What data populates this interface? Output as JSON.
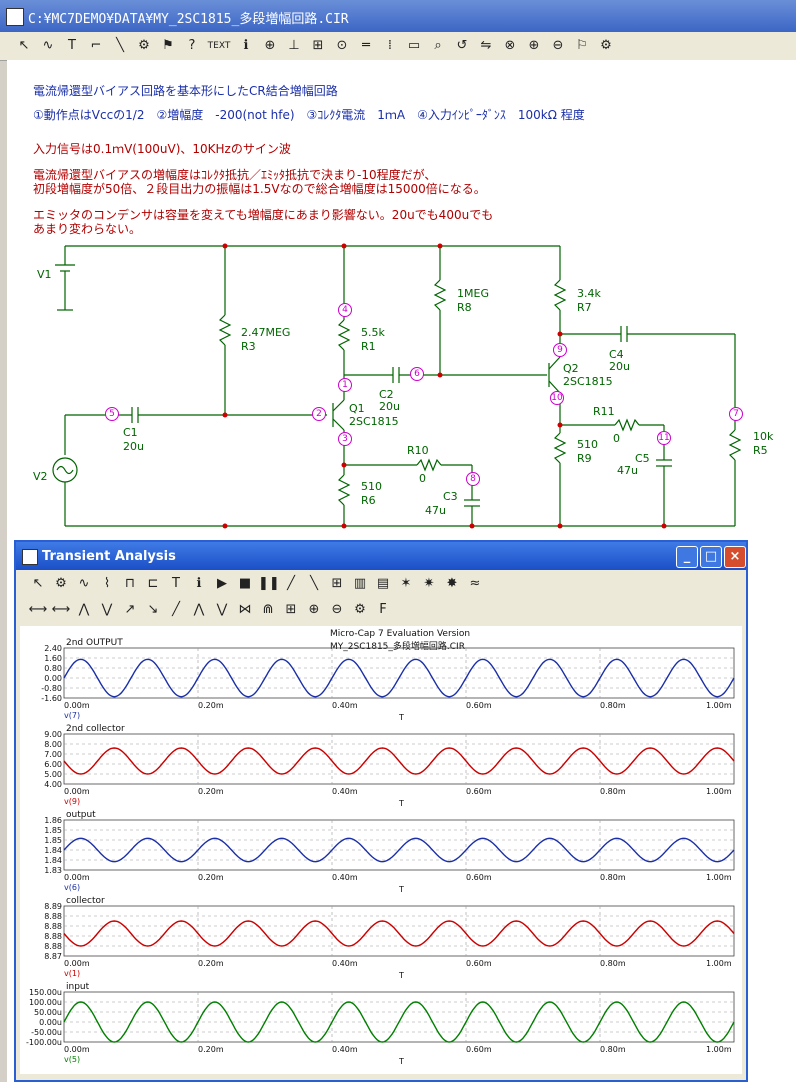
{
  "window_title": "C:¥MC7DEMO¥DATA¥MY_2SC1815_多段増幅回路.CIR",
  "toolbar_items": [
    "pointer-icon",
    "wire-icon",
    "text-tool-icon",
    "line-icon",
    "diagonal-icon",
    "component-icon",
    "flag-icon",
    "help-icon",
    "TEXT",
    "info-icon",
    "node-icon",
    "pin-icon",
    "grid-icon",
    "on-icon",
    "bus-icon",
    "dots-icon",
    "box-icon",
    "find-icon",
    "rotate-icon",
    "mirror-icon",
    "binoculars-icon",
    "zoom-in-icon",
    "zoom-out-icon",
    "flag2-icon",
    "settings-icon"
  ],
  "notes": {
    "line1": "電流帰還型バイアス回路を基本形にしたCR結合増幅回路",
    "line2": "①動作点はVccの1/2　②増幅度　-200(not hfe)　③ｺﾚｸﾀ電流　1ｍA　④入力ｲﾝﾋﾟｰﾀﾞﾝｽ　100kΩ 程度",
    "line3": "入力信号は0.1ｍV(100uV)、10KHzのサイン波",
    "line4": "電流帰還型バイアスの増幅度はｺﾚｸﾀ抵抗／ｴﾐｯﾀ抵抗で決まり-10程度だが、",
    "line5": "初段増幅度が50倍、２段目出力の振幅は1.5Vなので総合増幅度は15000倍になる。",
    "line6": "エミッタのコンデンサは容量を変えても増幅度にあまり影響ない。20uでも400uでも",
    "line7": "あまり変わらない。"
  },
  "schematic": {
    "V1": "V1",
    "V2": "V2",
    "R3": {
      "value": "2.47MEG",
      "name": "R3"
    },
    "R1": {
      "value": "5.5k",
      "name": "R1"
    },
    "R8": {
      "value": "1MEG",
      "name": "R8"
    },
    "R7": {
      "value": "3.4k",
      "name": "R7"
    },
    "C2": {
      "name": "C2",
      "value": "20u"
    },
    "C4": {
      "name": "C4",
      "value": "20u"
    },
    "Q1": {
      "name": "Q1",
      "part": "2SC1815"
    },
    "Q2": {
      "name": "Q2",
      "part": "2SC1815"
    },
    "C1": {
      "name": "C1",
      "value": "20u"
    },
    "R10": {
      "name": "R10",
      "value": "0"
    },
    "R6": {
      "value": "510",
      "name": "R6"
    },
    "C3": {
      "name": "C3",
      "value": "47u"
    },
    "R11": {
      "name": "R11",
      "value": "0"
    },
    "R9": {
      "value": "510",
      "name": "R9"
    },
    "C5": {
      "name": "C5",
      "value": "47u"
    },
    "R5": {
      "value": "10k",
      "name": "R5"
    },
    "nodes": [
      "1",
      "2",
      "3",
      "4",
      "5",
      "6",
      "7",
      "8",
      "9",
      "10",
      "11"
    ]
  },
  "analysis_window": {
    "title": "Transient Analysis",
    "header1": "Micro-Cap 7 Evaluation Version",
    "header2": "MY_2SC1815_多段増幅回路.CIR",
    "x_ticks": [
      "0.00m",
      "0.20m",
      "0.40m",
      "0.60m",
      "0.80m",
      "1.00m"
    ],
    "x_axis_label": "T"
  },
  "chart_data": [
    {
      "type": "line",
      "title": "2nd OUTPUT",
      "series": [
        {
          "name": "v(7)",
          "color": "#1a2fa8"
        }
      ],
      "yticks": [
        "2.40",
        "1.60",
        "0.80",
        "0.00",
        "-0.80",
        "-1.60"
      ],
      "ylim": [
        -1.6,
        2.4
      ],
      "amplitude": 1.5,
      "offset": 0.0,
      "cycles": 10,
      "xlim": [
        0,
        1.0
      ],
      "xunit": "m"
    },
    {
      "type": "line",
      "title": "2nd collector",
      "series": [
        {
          "name": "v(9)",
          "color": "#cc0000"
        }
      ],
      "yticks": [
        "9.00",
        "8.00",
        "7.00",
        "6.00",
        "5.00",
        "4.00"
      ],
      "ylim": [
        4.0,
        9.0
      ],
      "amplitude": 1.3,
      "offset": 6.3,
      "cycles": 10,
      "xlim": [
        0,
        1.0
      ],
      "xunit": "m"
    },
    {
      "type": "line",
      "title": "output",
      "series": [
        {
          "name": "v(6)",
          "color": "#1a2fa8"
        }
      ],
      "yticks": [
        "1.86",
        "1.85",
        "1.85",
        "1.84",
        "1.84",
        "1.83"
      ],
      "ylim": [
        1.83,
        1.86
      ],
      "amplitude": 0.007,
      "offset": 1.842,
      "cycles": 10,
      "xlim": [
        0,
        1.0
      ],
      "xunit": "m"
    },
    {
      "type": "line",
      "title": "collector",
      "series": [
        {
          "name": "v(1)",
          "color": "#cc0000"
        }
      ],
      "yticks": [
        "8.89",
        "8.88",
        "8.88",
        "8.88",
        "8.88",
        "8.87"
      ],
      "ylim": [
        8.87,
        8.89
      ],
      "amplitude": 0.005,
      "offset": 8.879,
      "cycles": 10,
      "xlim": [
        0,
        1.0
      ],
      "xunit": "m"
    },
    {
      "type": "line",
      "title": "input",
      "series": [
        {
          "name": "v(5)",
          "color": "#008000"
        }
      ],
      "yticks": [
        "150.00u",
        "100.00u",
        "50.00u",
        "0.00u",
        "-50.00u",
        "-100.00u"
      ],
      "ylim": [
        -100,
        150
      ],
      "amplitude": 100,
      "offset": 0,
      "cycles": 10,
      "xlim": [
        0,
        1.0
      ],
      "xunit": "m"
    }
  ]
}
